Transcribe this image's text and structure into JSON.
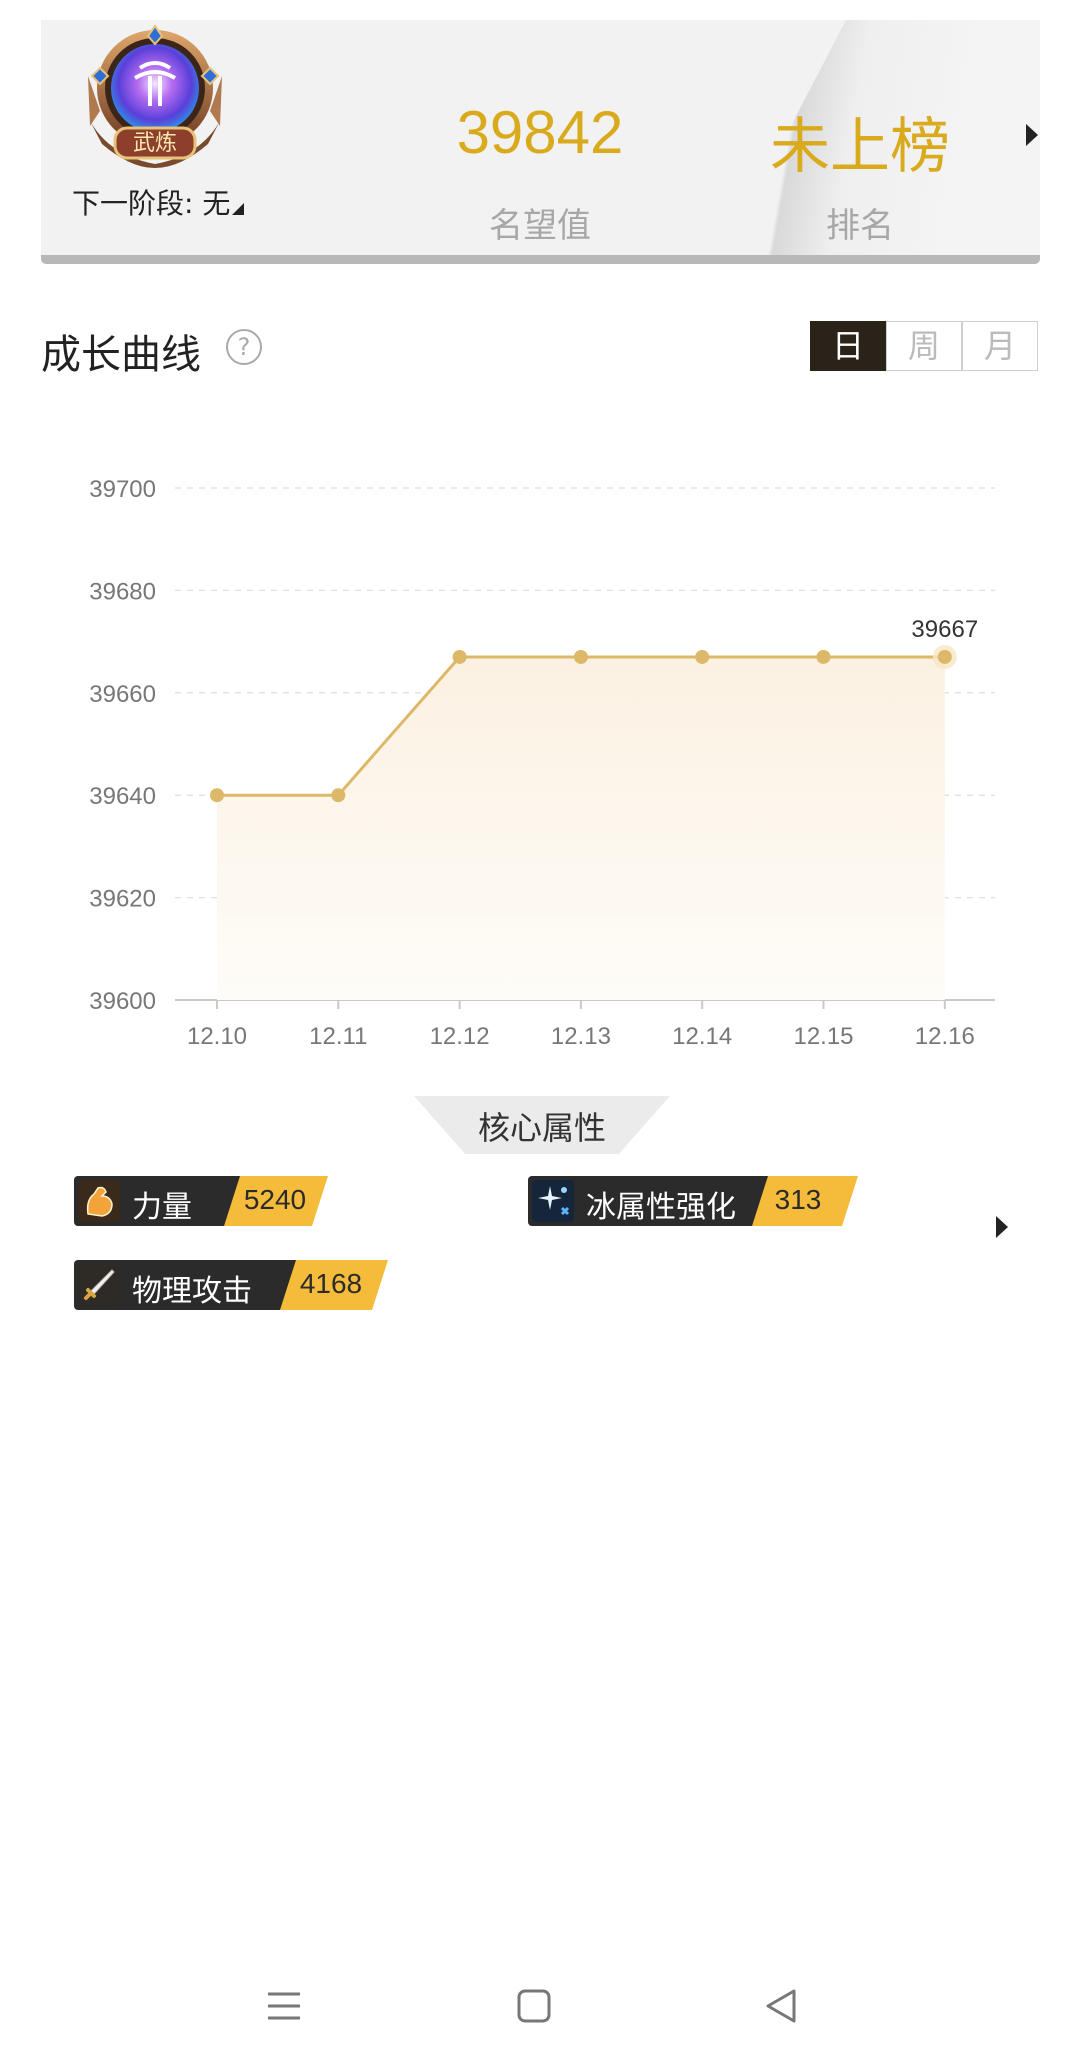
{
  "header": {
    "badge_text": "武炼",
    "next_stage": "下一阶段: 无",
    "reputation_value": "39842",
    "reputation_label": "名望值",
    "rank_value": "未上榜",
    "rank_label": "排名"
  },
  "growth": {
    "title": "成长曲线",
    "help": "?",
    "tabs": [
      {
        "label": "日",
        "active": true
      },
      {
        "label": "周",
        "active": false
      },
      {
        "label": "月",
        "active": false
      }
    ]
  },
  "chart_data": {
    "type": "line",
    "x": [
      "12.10",
      "12.11",
      "12.12",
      "12.13",
      "12.14",
      "12.15",
      "12.16"
    ],
    "values": [
      39640,
      39640,
      39667,
      39667,
      39667,
      39667,
      39667
    ],
    "y_ticks": [
      39600,
      39620,
      39640,
      39660,
      39680,
      39700
    ],
    "ylim": [
      39600,
      39700
    ],
    "last_label": "39667",
    "line_color": "#dcb868",
    "grid": true
  },
  "core": {
    "title": "核心属性",
    "attributes": [
      {
        "name": "力量",
        "value": "5240",
        "icon": "muscle-arm-icon"
      },
      {
        "name": "冰属性强化",
        "value": "313",
        "icon": "ice-sparkle-icon"
      },
      {
        "name": "物理攻击",
        "value": "4168",
        "icon": "sword-icon"
      }
    ]
  },
  "colors": {
    "accent_gold": "#d9aa1c",
    "tag_gold": "#f5bb3a",
    "dark": "#2b2219"
  }
}
